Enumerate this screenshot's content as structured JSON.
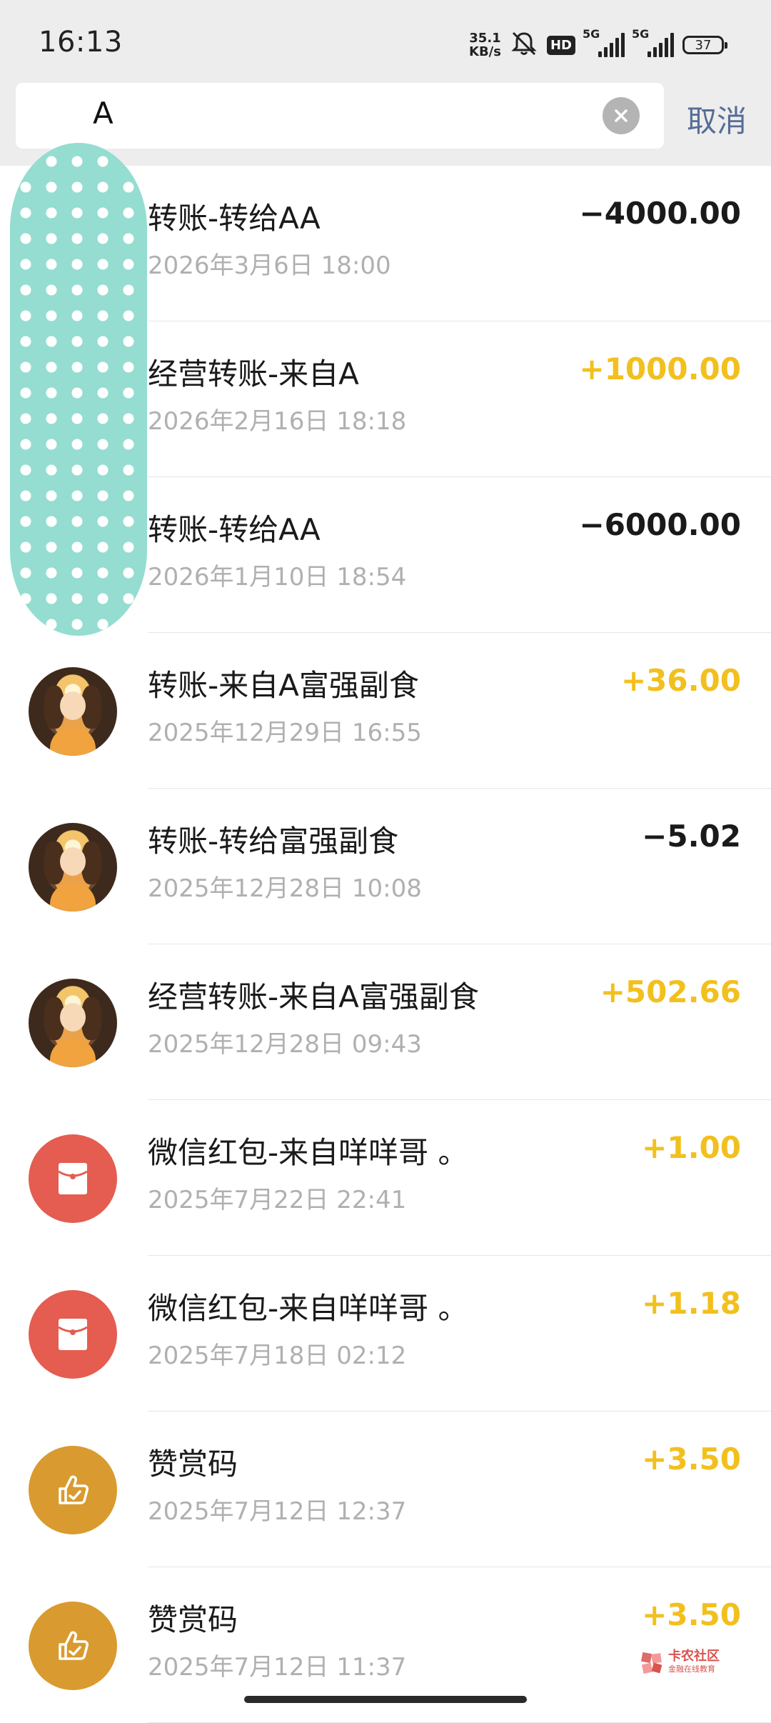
{
  "status_bar": {
    "time": "16:13",
    "net_speed_value": "35.1",
    "net_speed_unit": "KB/s",
    "hd_label": "HD",
    "signal_1_label": "5G",
    "signal_2_label": "5G",
    "battery_level": "37"
  },
  "search": {
    "query": "A",
    "cancel_label": "取消"
  },
  "colors": {
    "income": "#f2c01e",
    "expense": "#1a1a1a",
    "cancel": "#566d96",
    "redaction": "#94ddd0"
  },
  "transactions": [
    {
      "title": "转账-转给AA",
      "date": "2026年3月6日 18:00",
      "amount": "−4000.00",
      "type": "expense",
      "avatar": "redacted"
    },
    {
      "title": "经营转账-来自A",
      "date": "2026年2月16日 18:18",
      "amount": "+1000.00",
      "type": "income",
      "avatar": "redacted"
    },
    {
      "title": "转账-转给AA",
      "date": "2026年1月10日 18:54",
      "amount": "−6000.00",
      "type": "expense",
      "avatar": "redacted"
    },
    {
      "title": "转账-来自A富强副食",
      "date": "2025年12月29日 16:55",
      "amount": "+36.00",
      "type": "income",
      "avatar": "photo"
    },
    {
      "title": "转账-转给富强副食",
      "date": "2025年12月28日 10:08",
      "amount": "−5.02",
      "type": "expense",
      "avatar": "photo"
    },
    {
      "title": "经营转账-来自A富强副食",
      "date": "2025年12月28日 09:43",
      "amount": "+502.66",
      "type": "income",
      "avatar": "photo"
    },
    {
      "title": "微信红包-来自咩咩哥 。",
      "date": "2025年7月22日 22:41",
      "amount": "+1.00",
      "type": "income",
      "avatar": "red-packet-icon"
    },
    {
      "title": "微信红包-来自咩咩哥 。",
      "date": "2025年7月18日 02:12",
      "amount": "+1.18",
      "type": "income",
      "avatar": "red-packet-icon"
    },
    {
      "title": "赞赏码",
      "date": "2025年7月12日 12:37",
      "amount": "+3.50",
      "type": "income",
      "avatar": "thumbs-up-icon"
    },
    {
      "title": "赞赏码",
      "date": "2025年7月12日 11:37",
      "amount": "+3.50",
      "type": "income",
      "avatar": "thumbs-up-icon"
    }
  ],
  "watermark": {
    "main": "卡农社区",
    "sub": "金融在线教育"
  }
}
